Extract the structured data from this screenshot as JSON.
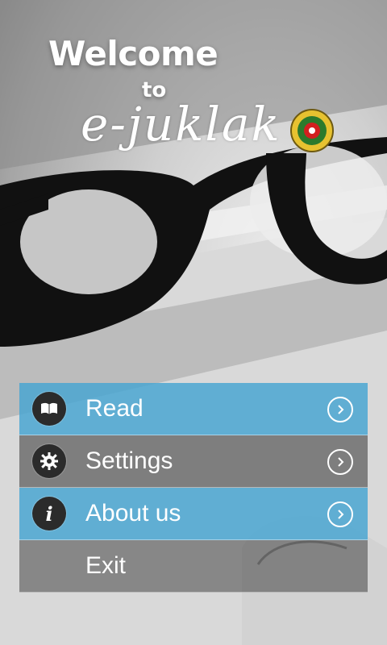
{
  "header": {
    "welcome": "Welcome",
    "to": "to",
    "app_name": "e-juklak"
  },
  "menu": {
    "items": [
      {
        "label": "Read",
        "icon": "book-icon"
      },
      {
        "label": "Settings",
        "icon": "gear-icon"
      },
      {
        "label": "About us",
        "icon": "info-icon"
      },
      {
        "label": "Exit",
        "icon": ""
      }
    ]
  },
  "colors": {
    "accent_blue": "#46a5d2",
    "menu_gray": "#464646"
  }
}
